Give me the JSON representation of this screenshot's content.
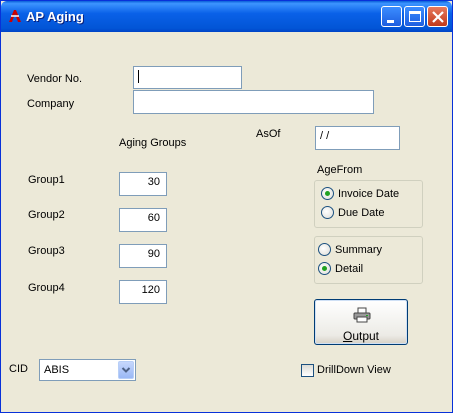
{
  "window": {
    "title": "AP Aging"
  },
  "form": {
    "vendor_label": "Vendor No.",
    "vendor_value": "",
    "company_label": "Company",
    "company_value": "",
    "aging_groups_label": "Aging Groups",
    "asof_label": "AsOf",
    "asof_value": " / /",
    "groups": [
      {
        "label": "Group1",
        "value": "30"
      },
      {
        "label": "Group2",
        "value": "60"
      },
      {
        "label": "Group3",
        "value": "90"
      },
      {
        "label": "Group4",
        "value": "120"
      }
    ],
    "agefrom_label": "AgeFrom",
    "agefrom_options": [
      {
        "label": "Invoice Date",
        "selected": true
      },
      {
        "label": "Due Date",
        "selected": false
      }
    ],
    "report_options": [
      {
        "label": "Summary",
        "selected": false
      },
      {
        "label": "Detail",
        "selected": true
      }
    ],
    "output_label_first": "O",
    "output_label_rest": "utput",
    "cid_label": "CID",
    "cid_value": "ABIS",
    "drilldown_label": "DrillDown View",
    "drilldown_checked": false
  },
  "icons": {
    "app": "app-icon",
    "minimize": "minimize-icon",
    "maximize": "maximize-icon",
    "close": "close-icon",
    "printer": "printer-icon",
    "dropdown": "chevron-down-icon"
  },
  "colors": {
    "titlebar": "#0a61e8",
    "window_bg": "#ece9d8",
    "radio_selected": "#21a121"
  }
}
